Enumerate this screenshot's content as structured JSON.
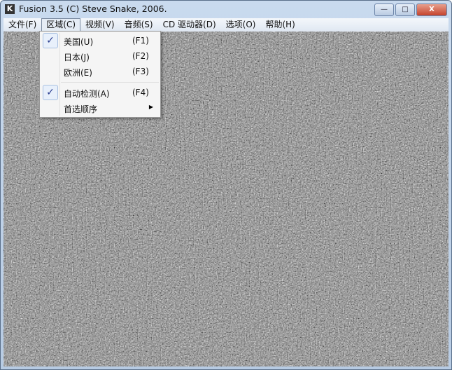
{
  "window": {
    "title": "Fusion 3.5 (C) Steve Snake, 2006.",
    "icon": "K",
    "min": "—",
    "max": "□",
    "close": "X"
  },
  "menubar": [
    "文件(F)",
    "区域(C)",
    "视频(V)",
    "音频(S)",
    "CD 驱动器(D)",
    "选项(O)",
    "帮助(H)"
  ],
  "dropdown": {
    "items": [
      {
        "label": "美国(U)",
        "key": "(F1)",
        "checked": true
      },
      {
        "label": "日本(J)",
        "key": "(F2)",
        "checked": false
      },
      {
        "label": "欧洲(E)",
        "key": "(F3)",
        "checked": false
      },
      {
        "label": "自动检测(A)",
        "key": "(F4)",
        "checked": true
      },
      {
        "label": "首选顺序",
        "key": "",
        "submenu": true
      }
    ],
    "check": "✓",
    "submenu_arrow": "▶"
  }
}
